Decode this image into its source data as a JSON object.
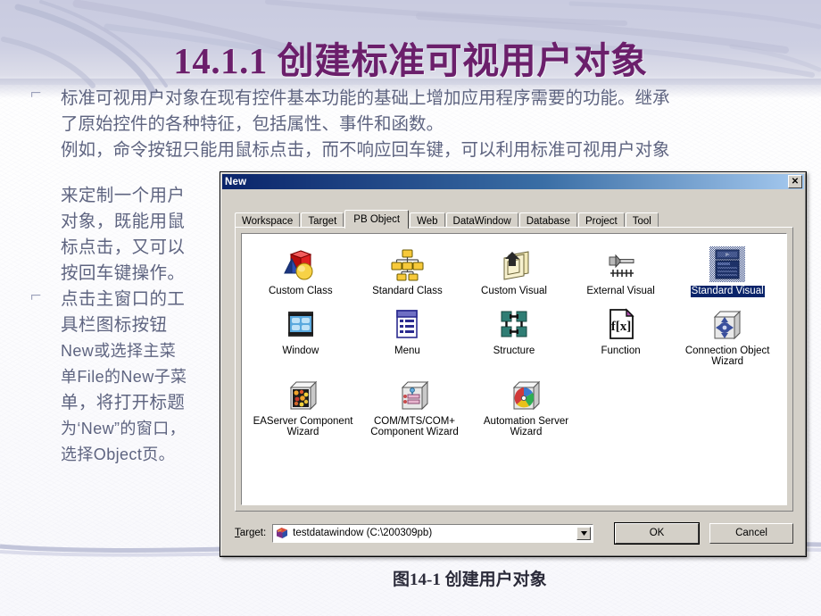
{
  "slide": {
    "title": "14.1.1 创建标准可视用户对象",
    "caption": "图14-1 创建用户对象",
    "paragraph_top_lines": [
      "标准可视用户对象在现有控件基本功能的基础上增加应用程序需要的功能。继承",
      "了原始控件的各种特征，包括属性、事件和函数。",
      "例如，命令按钮只能用鼠标点击，而不响应回车键，可以利用标准可视用户对象"
    ],
    "paragraph_left_lines": [
      "来定制一个用户",
      "对象，既能用鼠",
      "标点击，又可以",
      "按回车键操作。",
      "点击主窗口的工",
      "具栏图标按钮",
      "New或选择主菜",
      "单File的New子菜",
      "单，将打开标题",
      "为‘New”的窗口，",
      "选择Object页。"
    ],
    "bullet_glyph": "⌐"
  },
  "dialog": {
    "title": "New",
    "close_label": "✕",
    "tabs": [
      {
        "label": "Workspace",
        "active": false
      },
      {
        "label": "Target",
        "active": false
      },
      {
        "label": "PB Object",
        "active": true
      },
      {
        "label": "Web",
        "active": false
      },
      {
        "label": "DataWindow",
        "active": false
      },
      {
        "label": "Database",
        "active": false
      },
      {
        "label": "Project",
        "active": false
      },
      {
        "label": "Tool",
        "active": false
      }
    ],
    "icons": [
      [
        {
          "label": "Custom Class",
          "icon": "custom-class-icon",
          "selected": false
        },
        {
          "label": "Standard Class",
          "icon": "standard-class-icon",
          "selected": false
        },
        {
          "label": "Custom Visual",
          "icon": "custom-visual-icon",
          "selected": false
        },
        {
          "label": "External Visual",
          "icon": "external-visual-icon",
          "selected": false
        },
        {
          "label": "Standard Visual",
          "icon": "standard-visual-icon",
          "selected": true
        }
      ],
      [
        {
          "label": "Window",
          "icon": "window-icon",
          "selected": false
        },
        {
          "label": "Menu",
          "icon": "menu-icon",
          "selected": false
        },
        {
          "label": "Structure",
          "icon": "structure-icon",
          "selected": false
        },
        {
          "label": "Function",
          "icon": "function-icon",
          "selected": false
        },
        {
          "label": "Connection Object Wizard",
          "icon": "connection-object-wizard-icon",
          "selected": false
        }
      ],
      [
        {
          "label": "EAServer Component Wizard",
          "icon": "easerver-component-wizard-icon",
          "selected": false
        },
        {
          "label": "COM/MTS/COM+ Component Wizard",
          "icon": "com-mts-com-plus-component-wizard-icon",
          "selected": false
        },
        {
          "label": "Automation Server Wizard",
          "icon": "automation-server-wizard-icon",
          "selected": false
        }
      ]
    ],
    "bottom": {
      "target_label_prefix": "T",
      "target_label_rest": "arget:",
      "target_value": "testdatawindow (C:\\200309pb)",
      "combo_arrow": "▼",
      "ok_label": "OK",
      "cancel_label": "Cancel"
    }
  },
  "colors": {
    "title_purple": "#6b1f6b",
    "body_text": "#5e6480",
    "header_band": "#c9cbe0",
    "dialog_face": "#d4d0c8",
    "titlebar_start": "#0a246a",
    "selection_blue": "#0a246a"
  }
}
